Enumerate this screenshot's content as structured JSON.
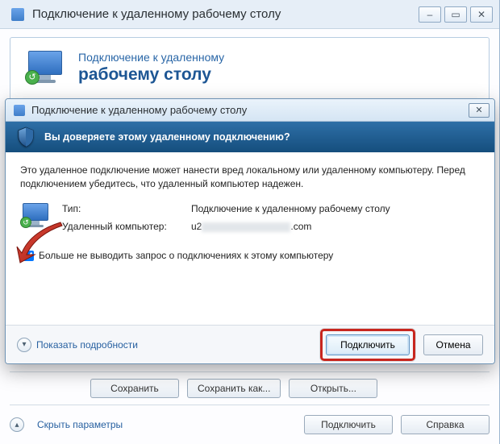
{
  "back_window": {
    "title": "Подключение к удаленному рабочему столу",
    "header_line1": "Подключение к удаленному",
    "header_line2": "рабочему столу",
    "btn_save": "Сохранить",
    "btn_save_as": "Сохранить как...",
    "btn_open": "Открыть...",
    "hide_params": "Скрыть параметры",
    "btn_connect": "Подключить",
    "btn_help": "Справка",
    "sys_minimize": "–",
    "sys_maximize": "▭",
    "sys_close": "✕"
  },
  "dialog": {
    "title": "Подключение к удаленному рабочему столу",
    "banner": "Вы доверяете этому удаленному подключению?",
    "message": "Это удаленное подключение может нанести вред локальному или удаленному компьютеру. Перед подключением убедитесь, что удаленный компьютер надежен.",
    "label_type": "Тип:",
    "value_type": "Подключение к удаленному рабочему столу",
    "label_remote": "Удаленный компьютер:",
    "value_remote_prefix": "u2",
    "value_remote_suffix": ".com",
    "checkbox_label": "Больше не выводить запрос о подключениях к этому компьютеру",
    "details_label": "Показать подробности",
    "btn_connect": "Подключить",
    "btn_cancel": "Отмена",
    "close_glyph": "✕",
    "chevron_down": "▾"
  }
}
